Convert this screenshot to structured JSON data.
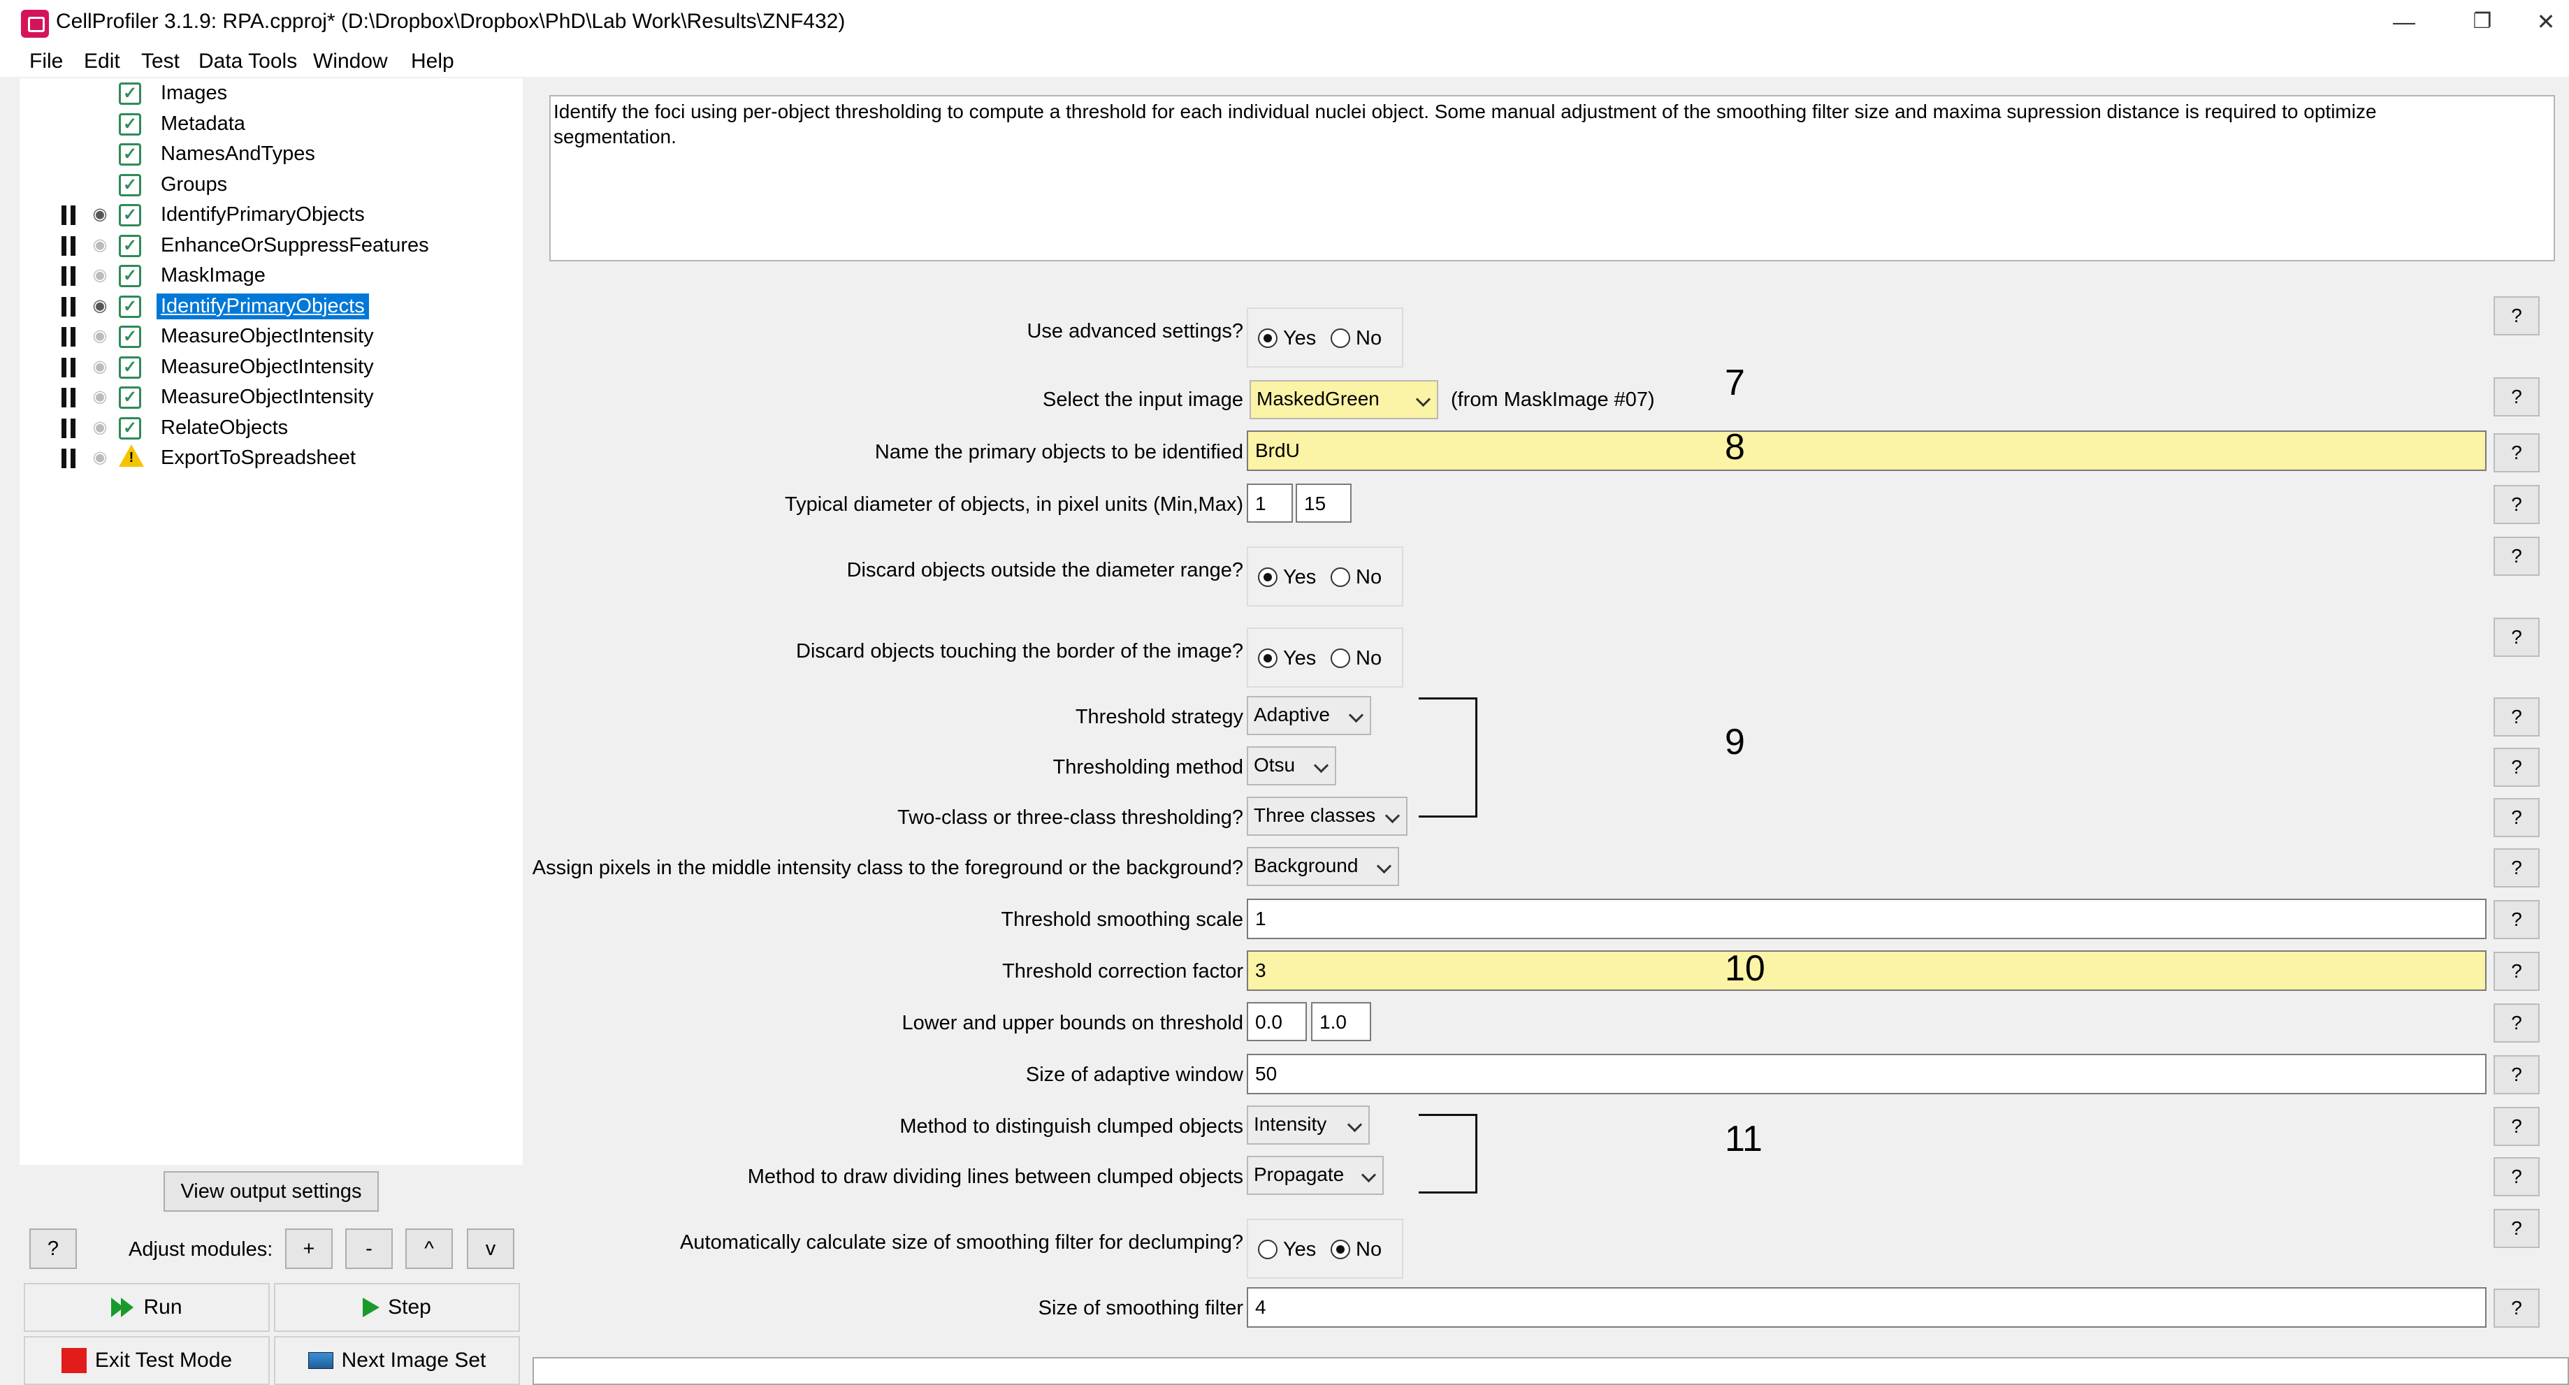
{
  "window": {
    "title": "CellProfiler 3.1.9: RPA.cpproj* (D:\\Dropbox\\Dropbox\\PhD\\Lab Work\\Results\\ZNF432)",
    "minimize": "—",
    "restore": "❐",
    "close": "✕"
  },
  "menu": [
    "File",
    "Edit",
    "Test",
    "Data Tools",
    "Window",
    "Help"
  ],
  "pipeline": {
    "modules": [
      {
        "label": "Images",
        "controls": false,
        "eye": "none",
        "status": "check",
        "selected": false
      },
      {
        "label": "Metadata",
        "controls": false,
        "eye": "none",
        "status": "check",
        "selected": false
      },
      {
        "label": "NamesAndTypes",
        "controls": false,
        "eye": "none",
        "status": "check",
        "selected": false
      },
      {
        "label": "Groups",
        "controls": false,
        "eye": "none",
        "status": "check",
        "selected": false
      },
      {
        "label": "IdentifyPrimaryObjects",
        "controls": true,
        "eye": "open",
        "status": "check",
        "selected": false
      },
      {
        "label": "EnhanceOrSuppressFeatures",
        "controls": true,
        "eye": "closed",
        "status": "check",
        "selected": false
      },
      {
        "label": "MaskImage",
        "controls": true,
        "eye": "closed",
        "status": "check",
        "selected": false
      },
      {
        "label": "IdentifyPrimaryObjects",
        "controls": true,
        "eye": "open",
        "status": "check",
        "selected": true
      },
      {
        "label": "MeasureObjectIntensity",
        "controls": true,
        "eye": "closed",
        "status": "check",
        "selected": false
      },
      {
        "label": "MeasureObjectIntensity",
        "controls": true,
        "eye": "closed",
        "status": "check",
        "selected": false
      },
      {
        "label": "MeasureObjectIntensity",
        "controls": true,
        "eye": "closed",
        "status": "check",
        "selected": false
      },
      {
        "label": "RelateObjects",
        "controls": true,
        "eye": "closed",
        "status": "check",
        "selected": false
      },
      {
        "label": "ExportToSpreadsheet",
        "controls": true,
        "eye": "closed",
        "status": "warning",
        "selected": false
      }
    ],
    "view_output_settings": "View output settings",
    "help": "?",
    "adjust_modules_label": "Adjust modules:",
    "adjust_buttons": [
      "+",
      "-",
      "^",
      "v"
    ],
    "run": "Run",
    "step": "Step",
    "exit_test_mode": "Exit Test Mode",
    "next_image_set": "Next Image Set"
  },
  "settings": {
    "description": "Identify the foci using per-object thresholding to compute a threshold for each individual nuclei object. Some manual adjustment of the smoothing filter size and maxima supression distance is required to optimize segmentation.",
    "help": "?",
    "yes": "Yes",
    "no": "No",
    "use_advanced": {
      "label": "Use advanced settings?",
      "value": "Yes"
    },
    "input_image": {
      "label": "Select the input image",
      "value": "MaskedGreen",
      "note": "(from MaskImage #07)"
    },
    "primary_objects": {
      "label": "Name the primary objects to be identified",
      "value": "BrdU"
    },
    "diameter": {
      "label": "Typical diameter of objects, in pixel units (Min,Max)",
      "min": "1",
      "max": "15"
    },
    "discard_outside": {
      "label": "Discard objects outside the diameter range?",
      "value": "Yes"
    },
    "discard_border": {
      "label": "Discard objects touching the border of the image?",
      "value": "Yes"
    },
    "threshold_strategy": {
      "label": "Threshold strategy",
      "value": "Adaptive"
    },
    "thresholding_method": {
      "label": "Thresholding method",
      "value": "Otsu"
    },
    "class_thresholding": {
      "label": "Two-class or three-class thresholding?",
      "value": "Three classes"
    },
    "middle_class": {
      "label": "Assign pixels in the middle intensity class to the foreground or the background?",
      "value": "Background"
    },
    "smoothing_scale": {
      "label": "Threshold smoothing scale",
      "value": "1"
    },
    "correction_factor": {
      "label": "Threshold correction factor",
      "value": "3"
    },
    "bounds": {
      "label": "Lower and upper bounds on threshold",
      "lower": "0.0",
      "upper": "1.0"
    },
    "adaptive_window": {
      "label": "Size of adaptive window",
      "value": "50"
    },
    "clumped_method": {
      "label": "Method to distinguish clumped objects",
      "value": "Intensity"
    },
    "dividing_lines": {
      "label": "Method to draw dividing lines between clumped objects",
      "value": "Propagate"
    },
    "auto_smoothing": {
      "label": "Automatically calculate size of smoothing filter for declumping?",
      "value": "No"
    },
    "smoothing_filter": {
      "label": "Size of smoothing filter",
      "value": "4"
    }
  },
  "annotations": [
    "7",
    "8",
    "9",
    "10",
    "11"
  ],
  "colors": {
    "highlight": "#fbf3a5",
    "selection": "#0078d7",
    "check": "#2e8b57",
    "run_green": "#1a9a2a",
    "stop_red": "#e21b1b"
  }
}
